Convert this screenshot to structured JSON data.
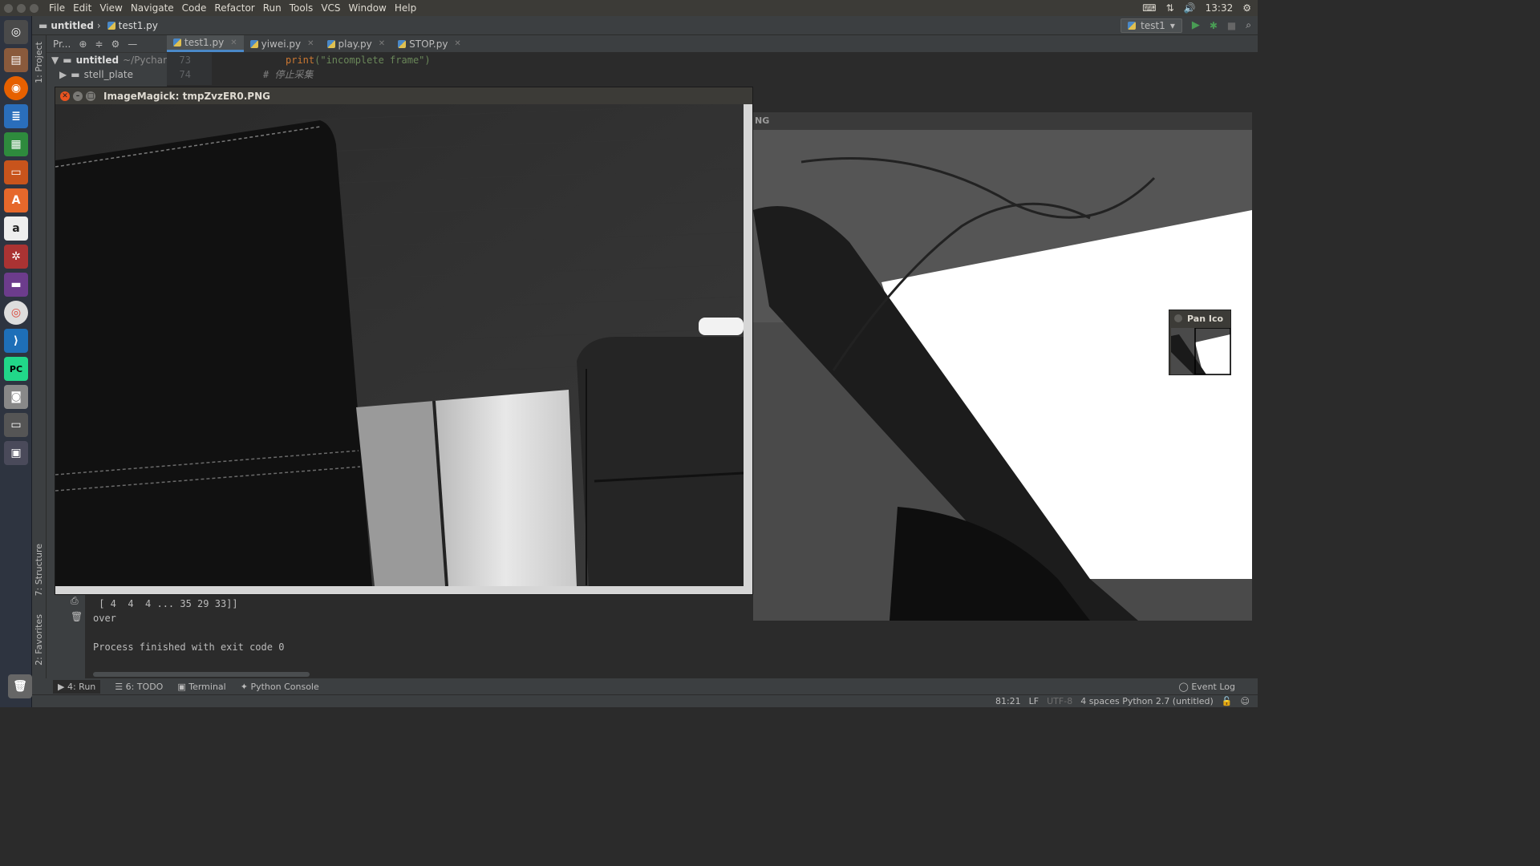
{
  "topbar": {
    "menus": [
      "File",
      "Edit",
      "View",
      "Navigate",
      "Code",
      "Refactor",
      "Run",
      "Tools",
      "VCS",
      "Window",
      "Help"
    ],
    "time": "13:32"
  },
  "navbar": {
    "project": "untitled",
    "file": "test1.py",
    "run_config": "test1"
  },
  "project_panel": {
    "title": "Pr...",
    "root_name": "untitled",
    "root_path": "~/PycharmP",
    "child": "stell_plate"
  },
  "tabs": [
    "test1.py",
    "yiwei.py",
    "play.py",
    "STOP.py"
  ],
  "editor": {
    "lines": [
      {
        "num": "73",
        "func": "print",
        "args": "(\"incomplete frame\")"
      },
      {
        "num": "74",
        "comment": "# 停止采集"
      }
    ]
  },
  "side_tabs": {
    "project": "1: Project",
    "structure": "7: Structure",
    "favorites": "2: Favorites"
  },
  "console": {
    "lines": [
      " [ 4  4  4 ... 35 29 33]]",
      "over",
      "",
      "Process finished with exit code 0"
    ]
  },
  "bottom_tabs": {
    "run": "4: Run",
    "todo": "6: TODO",
    "terminal": "Terminal",
    "python_console": "Python Console",
    "event_log": "Event Log"
  },
  "status": {
    "position": "81:21",
    "line_sep": "LF",
    "encoding": "UTF-8",
    "indent_interp": "4 spaces Python 2.7 (untitled)"
  },
  "imagemagick": {
    "front_title": "ImageMagick: tmpZvzER0.PNG",
    "back_title_fragment": "NG",
    "pan_icon_title": "Pan Ico"
  }
}
